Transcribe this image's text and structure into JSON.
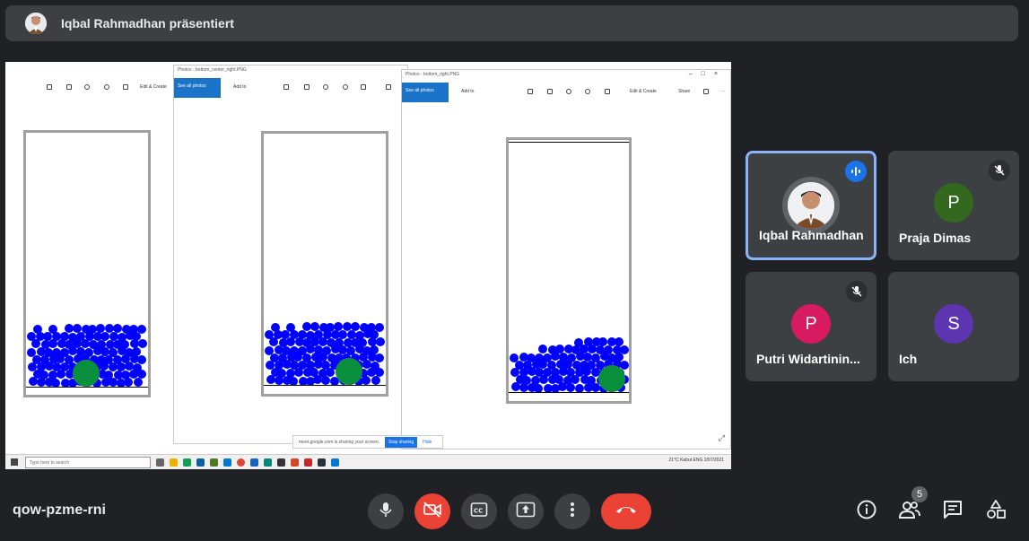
{
  "presenter": {
    "text": "Iqbal Rahmadhan präsentiert"
  },
  "screen": {
    "window1": {
      "title": "",
      "toolbar_label": "Edit & Create"
    },
    "window2": {
      "title": "Photos - bottom_center_right.PNG",
      "see_all": "See all photos",
      "add_to": "Add to"
    },
    "window3": {
      "title": "Photos - bottom_right.PNG",
      "see_all": "See all photos",
      "add_to": "Add to",
      "edit": "Edit & Create",
      "share": "Share"
    },
    "share_note": {
      "text": "meet.google.com is sharing your screen.",
      "stop": "Stop sharing",
      "hide": "Hide"
    },
    "taskbar": {
      "search": "Type here to search",
      "right": "21°C Kabut  ENG  2/07/2021"
    }
  },
  "participants": [
    {
      "name": "Iqbal Rahmadhan",
      "initial": "",
      "color": "#5f6368",
      "muted": false,
      "speaking": true
    },
    {
      "name": "Praja Dimas",
      "initial": "P",
      "color": "#33691e",
      "muted": true,
      "speaking": false
    },
    {
      "name": "Putri Widartinin...",
      "initial": "P",
      "color": "#d81b60",
      "muted": true,
      "speaking": false
    },
    {
      "name": "Ich",
      "initial": "S",
      "color": "#5e35b1",
      "muted": false,
      "speaking": false
    }
  ],
  "meeting": {
    "code": "qow-pzme-rni",
    "participant_count": "5"
  },
  "icons": {
    "mic": "mic-icon",
    "camera_off": "camera-off-icon",
    "captions": "captions-icon",
    "present": "present-icon",
    "more": "more-icon",
    "hangup": "hangup-icon",
    "info": "info-icon",
    "people": "people-icon",
    "chat": "chat-icon",
    "activities": "activities-icon"
  }
}
